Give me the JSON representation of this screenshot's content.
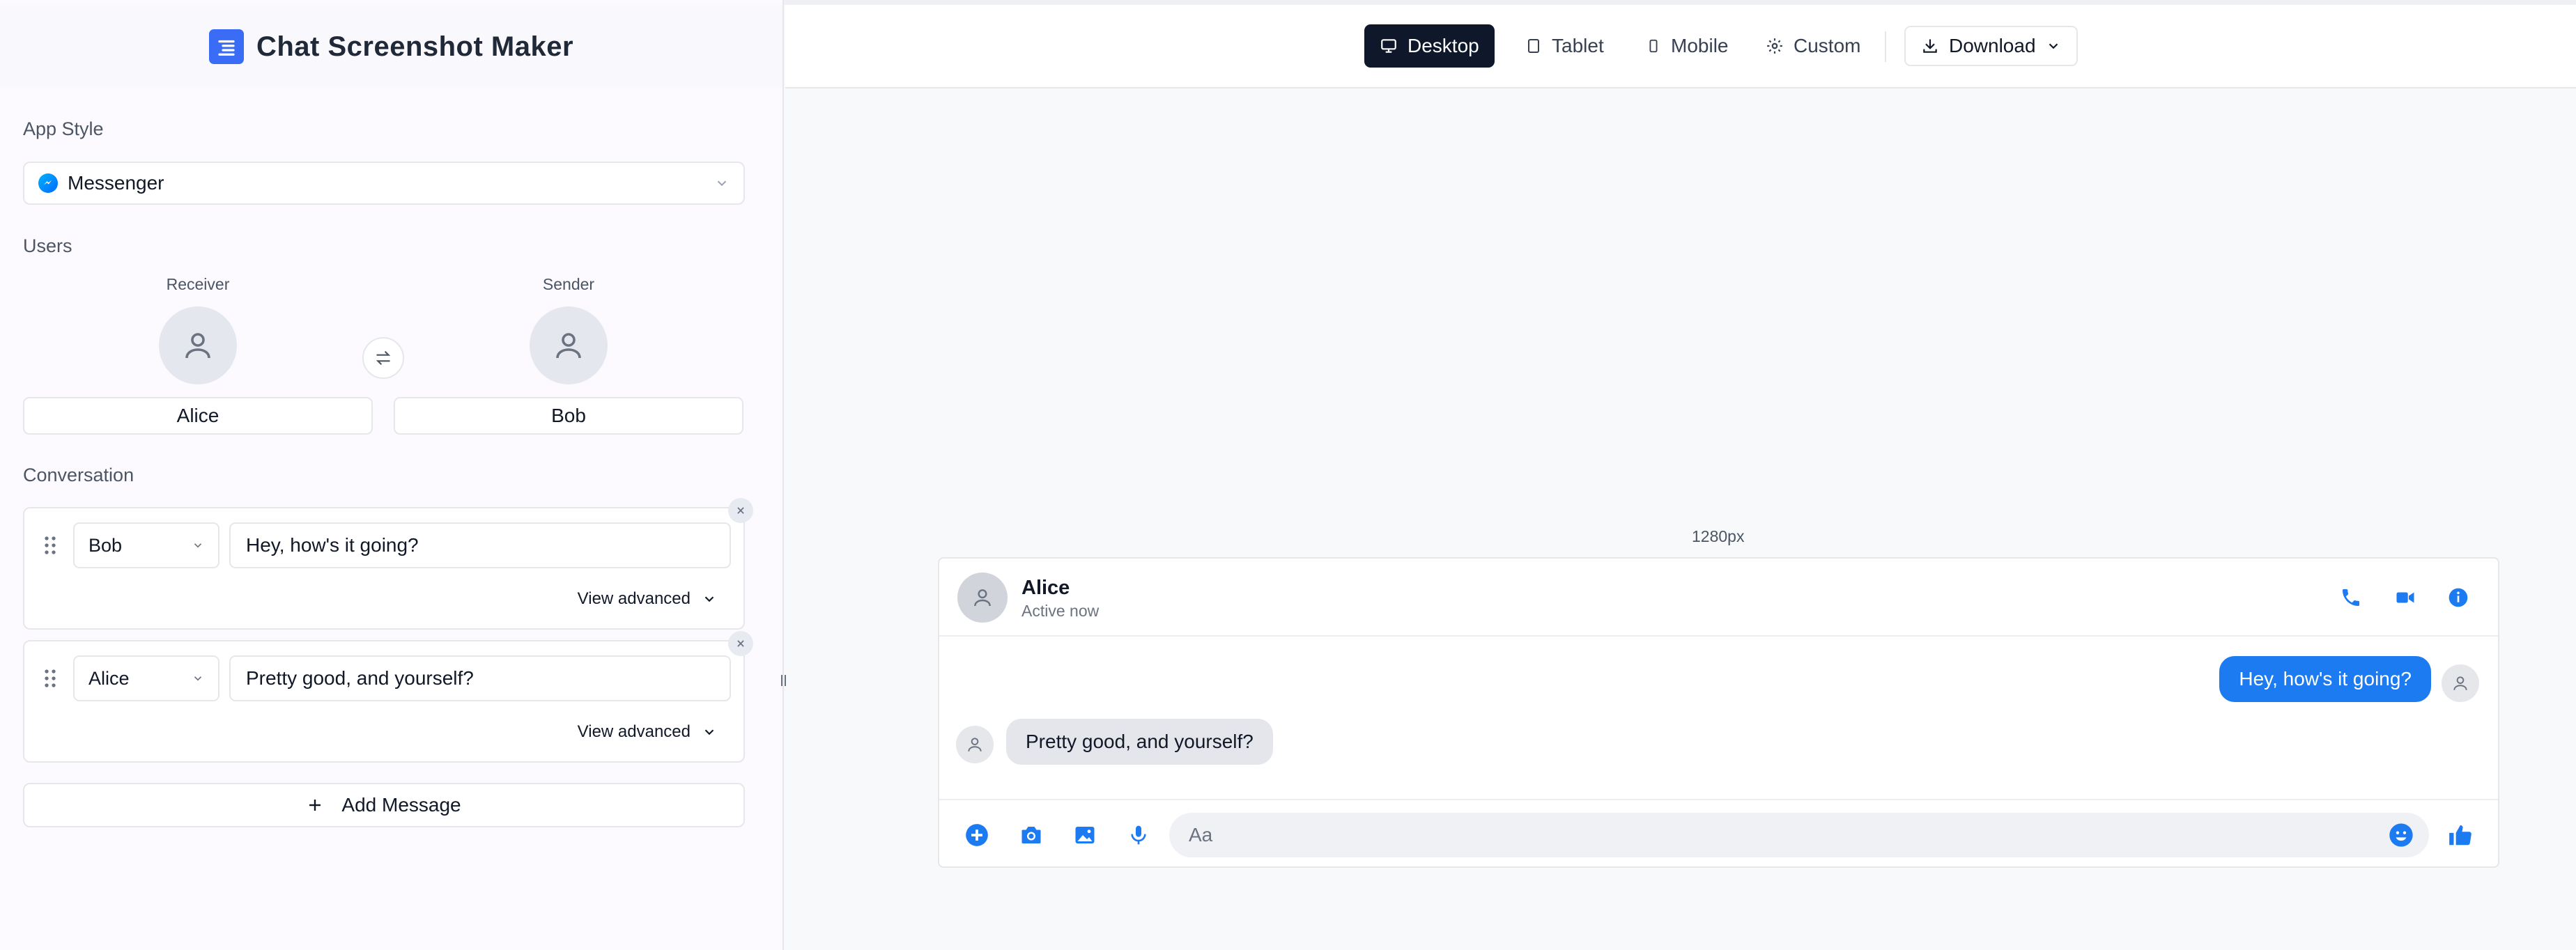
{
  "app": {
    "title": "Chat Screenshot Maker",
    "logo_icon": "list-icon"
  },
  "sidebar": {
    "app_style": {
      "label": "App Style",
      "value": "Messenger",
      "icon": "messenger-icon"
    },
    "users": {
      "label": "Users",
      "receiver": {
        "role": "Receiver",
        "name": "Alice"
      },
      "sender": {
        "role": "Sender",
        "name": "Bob"
      }
    },
    "conversation": {
      "label": "Conversation",
      "messages": [
        {
          "sender": "Bob",
          "text": "Hey, how's it going?",
          "advanced_label": "View advanced"
        },
        {
          "sender": "Alice",
          "text": "Pretty good, and yourself?",
          "advanced_label": "View advanced"
        }
      ],
      "add_label": "Add Message"
    }
  },
  "toolbar": {
    "devices": [
      {
        "label": "Desktop",
        "icon": "monitor-icon",
        "active": true
      },
      {
        "label": "Tablet",
        "icon": "tablet-icon",
        "active": false
      },
      {
        "label": "Mobile",
        "icon": "smartphone-icon",
        "active": false
      },
      {
        "label": "Custom",
        "icon": "gear-icon",
        "active": false
      }
    ],
    "download_label": "Download"
  },
  "preview": {
    "width_label": "1280px",
    "contact_name": "Alice",
    "contact_status": "Active now",
    "messages": [
      {
        "direction": "outgoing",
        "text": "Hey, how's it going?"
      },
      {
        "direction": "incoming",
        "text": "Pretty good, and yourself?"
      }
    ],
    "compose_placeholder": "Aa",
    "accent_color": "#1d7bf2"
  }
}
